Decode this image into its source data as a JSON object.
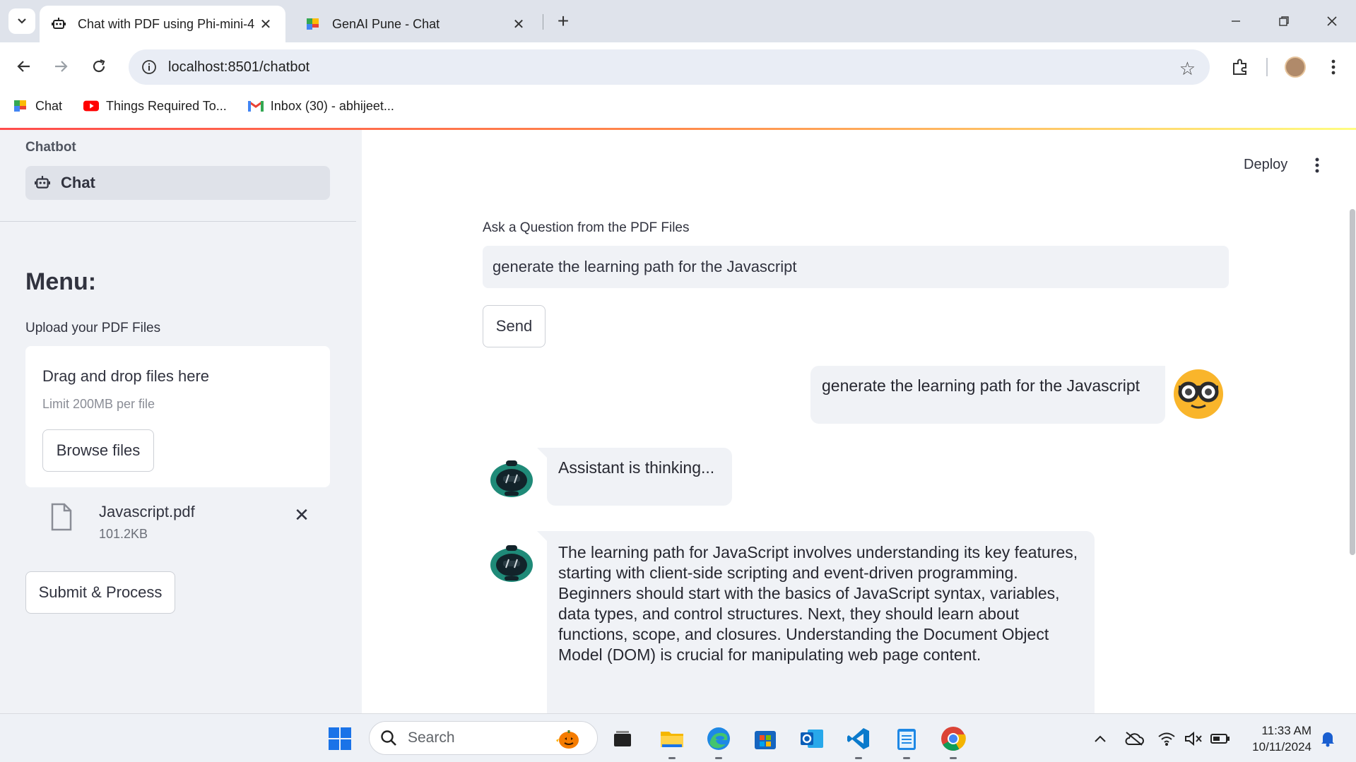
{
  "browser": {
    "tabs": [
      {
        "title": "Chat with PDF using Phi-mini-4",
        "active": true
      },
      {
        "title": "GenAI Pune - Chat",
        "active": false
      }
    ],
    "url": "localhost:8501/chatbot",
    "bookmarks": [
      {
        "label": "Chat",
        "icon": "google-chat-icon"
      },
      {
        "label": "Things Required To...",
        "icon": "youtube-icon"
      },
      {
        "label": "Inbox (30) - abhijeet...",
        "icon": "gmail-icon"
      }
    ]
  },
  "sidebar": {
    "nav_section_title": "Chatbot",
    "nav_items": [
      {
        "label": "Chat",
        "icon": "robot-icon"
      }
    ],
    "menu_title": "Menu:",
    "upload_label": "Upload your PDF Files",
    "dropzone": {
      "title": "Drag and drop files here",
      "limit": "Limit 200MB per file",
      "browse_label": "Browse files"
    },
    "uploaded_file": {
      "name": "Javascript.pdf",
      "size": "101.2KB"
    },
    "submit_label": "Submit & Process"
  },
  "main": {
    "deploy_label": "Deploy",
    "question_label": "Ask a Question from the PDF Files",
    "question_value": "generate the learning path for the Javascript",
    "send_label": "Send",
    "messages": [
      {
        "role": "user",
        "text": "generate the learning path for the Javascript"
      },
      {
        "role": "assistant",
        "text": "Assistant is thinking..."
      },
      {
        "role": "assistant",
        "text": "The learning path for JavaScript involves understanding its key features, starting with client-side scripting and event-driven programming. Beginners should start with the basics of JavaScript syntax, variables, data types, and control structures. Next, they should learn about functions, scope, and closures. Understanding the Document Object Model (DOM) is crucial for manipulating web page content."
      }
    ]
  },
  "taskbar": {
    "search_placeholder": "Search",
    "time": "11:33 AM",
    "date": "10/11/2024"
  },
  "colors": {
    "sidebar_bg": "#f0f2f6",
    "bubble_bg": "#f0f2f6",
    "accent_gradient_start": "#ff4b4b",
    "accent_gradient_end": "#fffd80"
  }
}
